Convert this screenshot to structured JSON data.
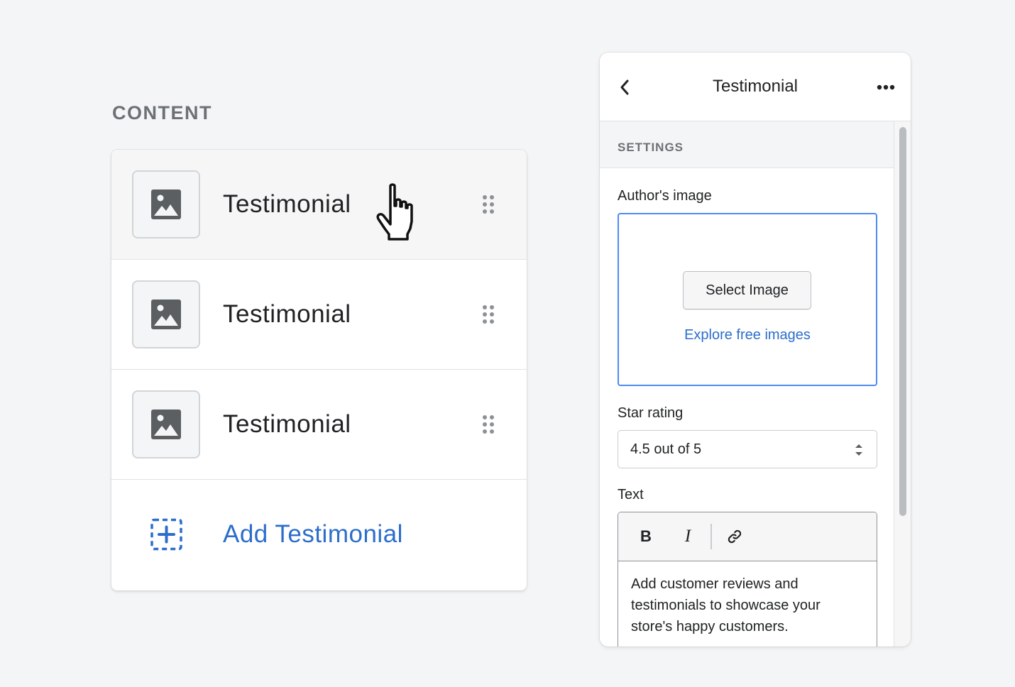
{
  "content_section": {
    "heading": "CONTENT",
    "items": [
      {
        "label": "Testimonial",
        "icon": "image-icon"
      },
      {
        "label": "Testimonial",
        "icon": "image-icon"
      },
      {
        "label": "Testimonial",
        "icon": "image-icon"
      }
    ],
    "add_label": "Add Testimonial"
  },
  "panel": {
    "title": "Testimonial",
    "settings_heading": "SETTINGS",
    "author_image": {
      "label": "Author's image",
      "select_button": "Select Image",
      "explore_link": "Explore free images"
    },
    "star_rating": {
      "label": "Star rating",
      "value": "4.5 out of 5"
    },
    "text_field": {
      "label": "Text",
      "toolbar": {
        "bold": "B",
        "italic": "I"
      },
      "value": "Add customer reviews and testimonials to showcase your store's happy customers."
    }
  },
  "colors": {
    "accent_blue": "#2c6ecb",
    "focus_border": "#4c8bf5",
    "background": "#f4f5f6",
    "icon_gray": "#5c5f62"
  }
}
